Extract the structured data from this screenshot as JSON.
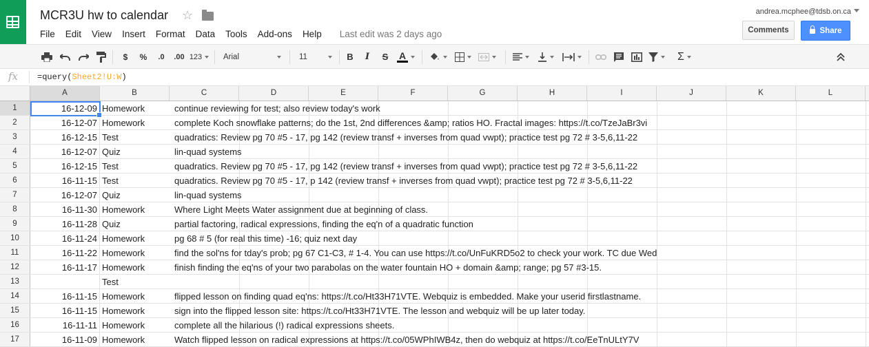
{
  "header": {
    "title": "MCR3U hw to calendar",
    "menu": [
      "File",
      "Edit",
      "View",
      "Insert",
      "Format",
      "Data",
      "Tools",
      "Add-ons",
      "Help"
    ],
    "last_edit": "Last edit was 2 days ago",
    "account_email": "andrea.mcphee@tdsb.on.ca",
    "comments_label": "Comments",
    "share_label": "Share"
  },
  "toolbar": {
    "currency": "$",
    "percent": "%",
    "decrease_decimal": ".0",
    "increase_decimal": ".00",
    "number_format": "123",
    "font": "Arial",
    "font_size": "11",
    "bold": "B",
    "italic": "I",
    "strikethrough": "S",
    "text_color": "A",
    "functions": "Σ"
  },
  "formula_bar": {
    "fx": "fx",
    "prefix": "=query(",
    "range": "Sheet2!U:W",
    "suffix": ")"
  },
  "columns": [
    "A",
    "B",
    "C",
    "D",
    "E",
    "F",
    "G",
    "H",
    "I",
    "J",
    "K",
    "L"
  ],
  "rows": [
    {
      "num": "1",
      "date": "16-12-09",
      "type": "Homework",
      "desc": "continue reviewing for test; also review today's work"
    },
    {
      "num": "2",
      "date": "16-12-07",
      "type": "Homework",
      "desc": "complete Koch snowflake patterns; do the 1st, 2nd differences &amp; ratios HO. Fractal images: https://t.co/TzeJaBr3vi"
    },
    {
      "num": "3",
      "date": "16-12-15",
      "type": "Test",
      "desc": "quadratics: Review pg 70 #5 - 17, pg 142 (review transf + inverses from quad vwpt); practice test pg 72 # 3-5,6,11-22"
    },
    {
      "num": "4",
      "date": "16-12-07",
      "type": "Quiz",
      "desc": "lin-quad systems"
    },
    {
      "num": "5",
      "date": "16-12-15",
      "type": "Test",
      "desc": "quadratics. Review pg 70 #5 - 17, pg 142 (review transf + inverses from quad vwpt); practice test pg 72 # 3-5,6,11-22"
    },
    {
      "num": "6",
      "date": "16-11-15",
      "type": "Test",
      "desc": "quadratics. Review pg 70 #5 - 17, p 142 (review transf + inverses from quad vwpt); practice test pg 72 # 3-5,6,11-22"
    },
    {
      "num": "7",
      "date": "16-12-07",
      "type": "Quiz",
      "desc": "lin-quad systems"
    },
    {
      "num": "8",
      "date": "16-11-30",
      "type": "Homework",
      "desc": "Where Light Meets Water assignment due at beginning of class."
    },
    {
      "num": "9",
      "date": "16-11-28",
      "type": "Quiz",
      "desc": "partial factoring, radical expressions, finding the eq'n of a quadratic function"
    },
    {
      "num": "10",
      "date": "16-11-24",
      "type": "Homework",
      "desc": "pg 68 # 5 (for real this time) -16; quiz next day"
    },
    {
      "num": "11",
      "date": "16-11-22",
      "type": "Homework",
      "desc": "find the sol'ns for tday's prob; pg 67 C1-C3, # 1-4. You can use https://t.co/UnFuKRD5o2 to check your work. TC due Wed"
    },
    {
      "num": "12",
      "date": "16-11-17",
      "type": "Homework",
      "desc": "finish finding the eq'ns of your two parabolas on the water fountain HO + domain &amp; range; pg 57 #3-15."
    },
    {
      "num": "13",
      "date": "",
      "type": "Test",
      "desc": ""
    },
    {
      "num": "14",
      "date": "16-11-15",
      "type": "Homework",
      "desc": "flipped lesson on finding quad eq'ns: https://t.co/Ht33H71VTE. Webquiz is embedded. Make your userid firstlastname."
    },
    {
      "num": "15",
      "date": "16-11-15",
      "type": "Homework",
      "desc": "sign into the flipped lesson site: https://t.co/Ht33H71VTE. The lesson and webquiz will be up later today."
    },
    {
      "num": "16",
      "date": "16-11-11",
      "type": "Homework",
      "desc": "complete all the hilarious (!) radical expressions sheets."
    },
    {
      "num": "17",
      "date": "16-11-09",
      "type": "Homework",
      "desc": "Watch flipped lesson on radical expressions at https://t.co/05WPhIWB4z, then do webquiz at https://t.co/EeTnULtY7V"
    }
  ]
}
